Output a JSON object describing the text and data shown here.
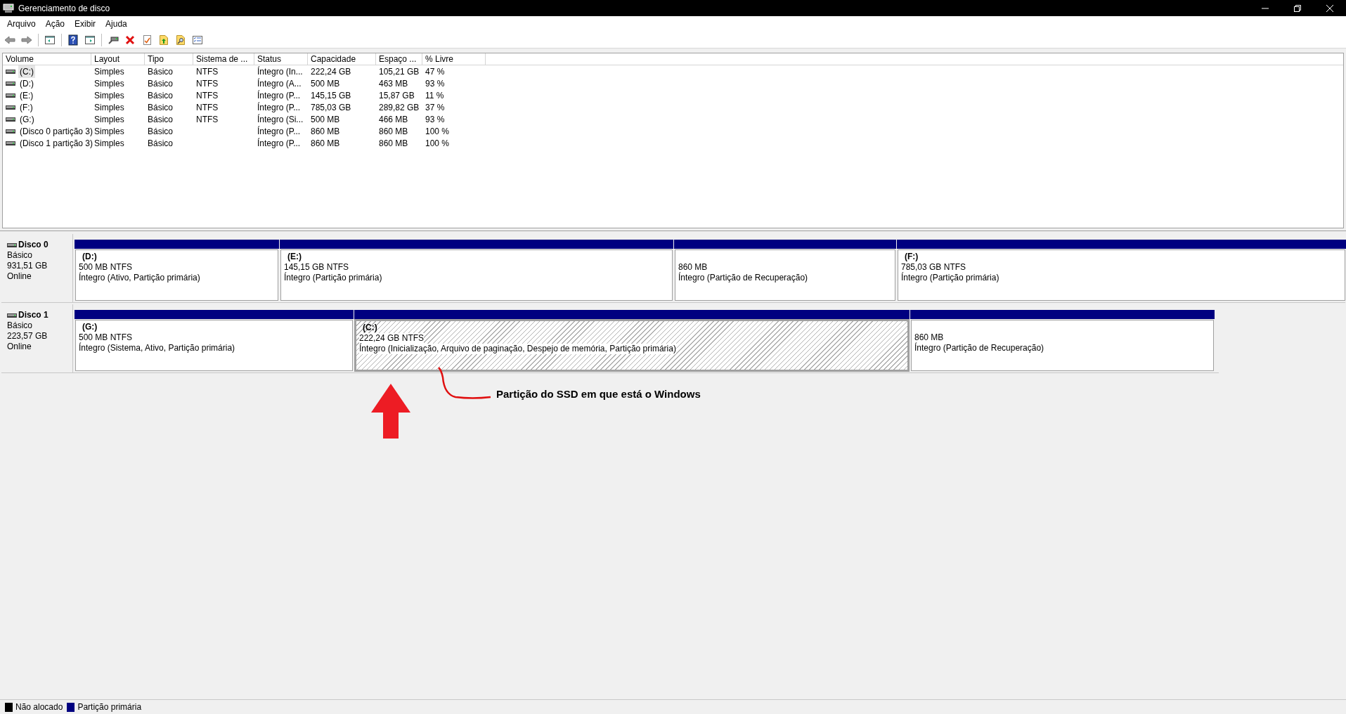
{
  "window": {
    "title": "Gerenciamento de disco"
  },
  "menu": [
    "Arquivo",
    "Ação",
    "Exibir",
    "Ajuda"
  ],
  "volumes": {
    "columns": [
      "Volume",
      "Layout",
      "Tipo",
      "Sistema de ...",
      "Status",
      "Capacidade",
      "Espaço ...",
      "% Livre"
    ],
    "rows": [
      {
        "cells": [
          "(C:)",
          "Simples",
          "Básico",
          "NTFS",
          "Íntegro (In...",
          "222,24 GB",
          "105,21 GB",
          "47 %"
        ],
        "selected": true
      },
      {
        "cells": [
          "(D:)",
          "Simples",
          "Básico",
          "NTFS",
          "Íntegro (A...",
          "500 MB",
          "463 MB",
          "93 %"
        ],
        "selected": false
      },
      {
        "cells": [
          "(E:)",
          "Simples",
          "Básico",
          "NTFS",
          "Íntegro (P...",
          "145,15 GB",
          "15,87 GB",
          "11 %"
        ],
        "selected": false
      },
      {
        "cells": [
          "(F:)",
          "Simples",
          "Básico",
          "NTFS",
          "Íntegro (P...",
          "785,03 GB",
          "289,82 GB",
          "37 %"
        ],
        "selected": false
      },
      {
        "cells": [
          "(G:)",
          "Simples",
          "Básico",
          "NTFS",
          "Íntegro (Si...",
          "500 MB",
          "466 MB",
          "93 %"
        ],
        "selected": false
      },
      {
        "cells": [
          "(Disco 0 partição 3)",
          "Simples",
          "Básico",
          "",
          "Íntegro (P...",
          "860 MB",
          "860 MB",
          "100 %"
        ],
        "selected": false
      },
      {
        "cells": [
          "(Disco 1 partição 3)",
          "Simples",
          "Básico",
          "",
          "Íntegro (P...",
          "860 MB",
          "860 MB",
          "100 %"
        ],
        "selected": false
      }
    ]
  },
  "disks": [
    {
      "name": "Disco 0",
      "type": "Básico",
      "size": "931,51 GB",
      "status": "Online",
      "partitions": [
        {
          "label": "(D:)",
          "size": "500 MB NTFS",
          "status": "Íntegro (Ativo, Partição primária)",
          "selected": false
        },
        {
          "label": "(E:)",
          "size": "145,15 GB NTFS",
          "status": "Íntegro (Partição primária)",
          "selected": false
        },
        {
          "size": "860 MB",
          "status": "Íntegro (Partição de Recuperação)",
          "selected": false
        },
        {
          "label": "(F:)",
          "size": "785,03 GB NTFS",
          "status": "Íntegro (Partição primária)",
          "selected": false
        }
      ]
    },
    {
      "name": "Disco 1",
      "type": "Básico",
      "size": "223,57 GB",
      "status": "Online",
      "partitions": [
        {
          "label": "(G:)",
          "size": "500 MB NTFS",
          "status": "Íntegro (Sistema, Ativo, Partição primária)",
          "selected": false
        },
        {
          "label": "(C:)",
          "size": "222,24 GB NTFS",
          "status": "Íntegro (Inicialização, Arquivo de paginação, Despejo de memória, Partição primária)",
          "selected": true
        },
        {
          "size": "860 MB",
          "status": "Íntegro (Partição de Recuperação)",
          "selected": false
        }
      ]
    }
  ],
  "annotation": {
    "text": "Partição do SSD em que está o Windows"
  },
  "legend": [
    {
      "label": "Não alocado",
      "color": "#000000"
    },
    {
      "label": "Partição primária",
      "color": "#000080"
    }
  ]
}
